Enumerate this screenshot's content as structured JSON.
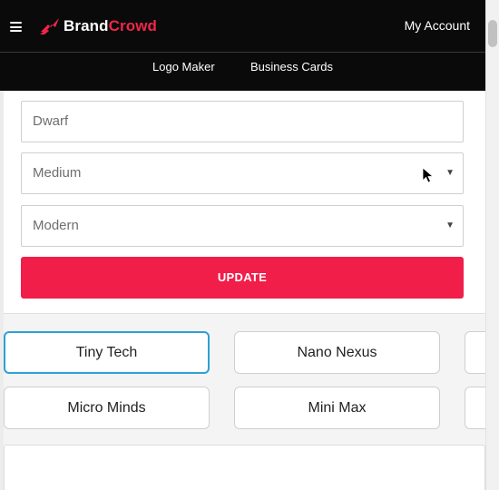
{
  "header": {
    "logo": {
      "brand": "Brand",
      "crowd": "Crowd"
    },
    "account_label": "My Account",
    "nav": [
      "Logo Maker",
      "Business Cards"
    ]
  },
  "form": {
    "name_value": "Dwarf",
    "size_value": "Medium",
    "style_value": "Modern",
    "update_label": "UPDATE"
  },
  "results": {
    "names": [
      "Tiny Tech",
      "Nano Nexus",
      "",
      "Micro Minds",
      "Mini Max",
      ""
    ],
    "selected": "Tiny Tech"
  },
  "colors": {
    "accent": "#f01e49",
    "selected_border": "#2ea0d6",
    "header_bg": "#0a0a0a"
  },
  "icons": [
    "hamburger-menu-icon",
    "brandcrowd-logo-icon",
    "dropdown-caret-icon",
    "mouse-pointer-icon"
  ]
}
